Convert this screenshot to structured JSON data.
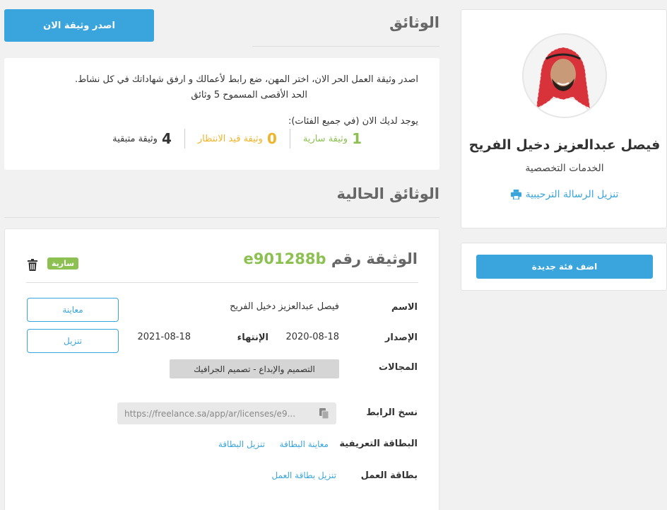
{
  "profile": {
    "name": "فيصل عبدالعزيز دخيل الفريح",
    "role": "الخدمات التخصصية",
    "welcome_letter_link": "تنزيل الرسالة الترحيبية"
  },
  "sidebar": {
    "add_category_label": "اضف فئة جديدة"
  },
  "documents_section": {
    "title": "الوثائق",
    "issue_button_label": "اصدر وثيقة الان",
    "info_line_1": "اصدر وثيقة العمل الحر الان، اختر المهن، ضع رابط لأعمالك و ارفق شهاداتك في كل نشاط.",
    "info_line_2": "الحد الأقصى المسموح 5 وثائق",
    "status_heading": "يوجد لديك الان (في جميع الفئات):",
    "stats": [
      {
        "count": "1",
        "label": "وثيقة سارية",
        "color": "#8cc152"
      },
      {
        "count": "0",
        "label": "وثيقة قيد الانتظار",
        "color": "#f0b429"
      },
      {
        "count": "4",
        "label": "وثيقة متبقية",
        "color": "#333333"
      }
    ]
  },
  "current_section": {
    "title": "الوثائق الحالية"
  },
  "document": {
    "title_prefix": "الوثيقة رقم",
    "id": "e901288b",
    "status_badge": "سارية",
    "name_label": "الاسم",
    "name_value": "فيصل عبدالعزيز دخيل الفريح",
    "issue_label": "الإصدار",
    "issue_value": "2020-08-18",
    "expiry_label": "الإنتهاء",
    "expiry_value": "2021-08-18",
    "fields_label": "المجالات",
    "fields_value": "التصميم والإبداع - تصميم الجرافيك",
    "preview_button": "معاينة",
    "download_button": "تنزيل",
    "copy_link_label": "نسخ الرابط",
    "link_value": "https://freelance.sa/app/ar/licenses/e9...",
    "id_card_label": "البطاقة التعريفية",
    "id_card_preview": "معاينة البطاقة",
    "id_card_download": "تنزيل البطاقة",
    "work_card_label": "بطاقة العمل",
    "work_card_download": "تنزيل بطاقة العمل"
  },
  "colors": {
    "accent": "#3aa5dc",
    "active_green": "#8cc152",
    "pending_yellow": "#f0b429"
  },
  "icons": [
    "print-icon",
    "trash-icon",
    "copy-icon"
  ]
}
